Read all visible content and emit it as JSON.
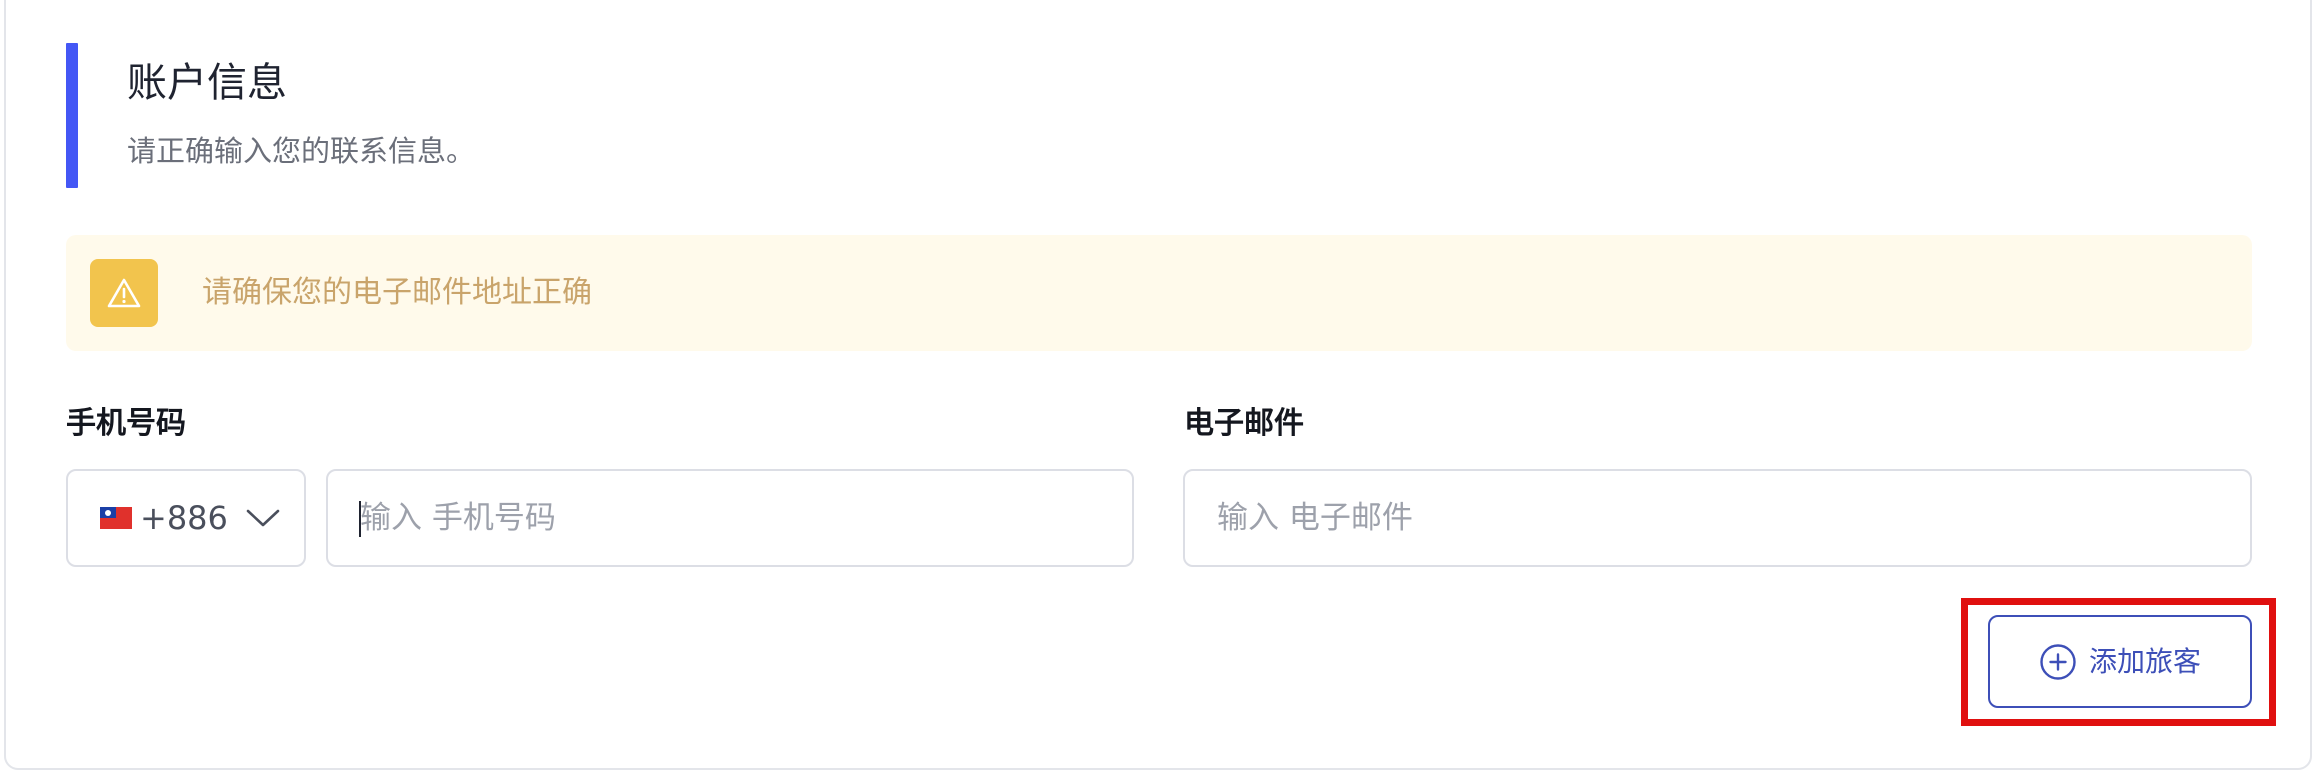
{
  "section": {
    "title": "账户信息",
    "subtitle": "请正确输入您的联系信息。"
  },
  "alert": {
    "icon": "warning-triangle-icon",
    "text": "请确保您的电子邮件地址正确",
    "background_color": "#fffaeb",
    "icon_color": "#f2c44d"
  },
  "phone": {
    "label": "手机号码",
    "country": {
      "flag_icon": "taiwan-flag-icon",
      "dial_code": "+886",
      "dropdown_icon": "chevron-down-icon"
    },
    "placeholder": "输入 手机号码",
    "value": ""
  },
  "email": {
    "label": "电子邮件",
    "placeholder": "输入 电子邮件",
    "value": ""
  },
  "add_traveler": {
    "label": "添加旅客",
    "icon": "plus-circle-icon",
    "color": "#3d4fb8"
  },
  "accent_color": "#4457f5",
  "highlight_color": "#e0100f"
}
